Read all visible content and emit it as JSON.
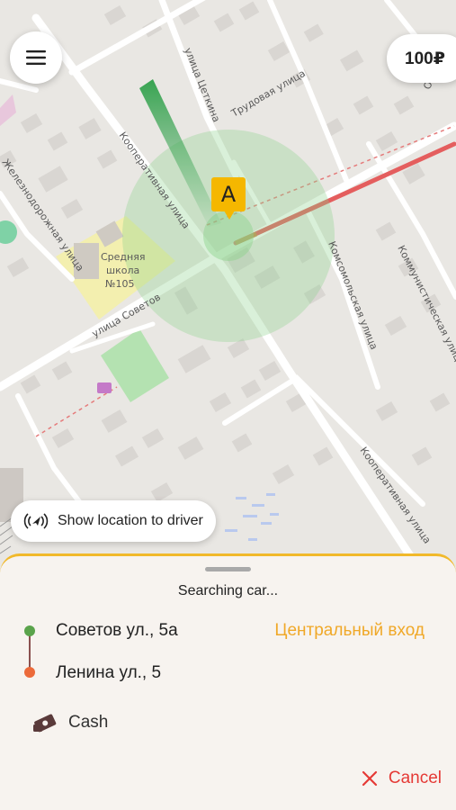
{
  "map": {
    "streets": {
      "tsetkina": "улица Цеткина",
      "trudovaya": "Трудовая улица",
      "kooperativnaya_top": "Кооперативная улица",
      "zheleznodorozhnaya": "Железнодорожная улица",
      "sovetov": "улица Советов",
      "komsomolskaya": "Комсомольская улица",
      "kommunisticheskaya": "Коммунистическая улица",
      "kooperativnaya_bottom": "Кооперативная улица",
      "osipenko": "Осипенко"
    },
    "school": {
      "line1": "Средняя",
      "line2": "школа",
      "line3": "№105"
    },
    "pickup_marker": "A"
  },
  "header": {
    "price": "100₽"
  },
  "show_location": {
    "label": "Show location to driver"
  },
  "sheet": {
    "status": "Searching car...",
    "from": "Советов ул., 5а",
    "entrance": "Центральный вход",
    "to": "Ленина ул., 5",
    "payment": "Cash",
    "cancel": "Cancel"
  },
  "colors": {
    "accent": "#f5b700",
    "sheet_border": "#f1b92a",
    "entrance": "#f0a828",
    "cancel": "#e53935",
    "origin_dot": "#5aa34b",
    "dest_dot": "#ec6a3a"
  },
  "icons": {
    "menu": "hamburger-menu-icon",
    "location": "location-broadcast-icon",
    "payment": "cash-icon",
    "cancel": "close-icon"
  }
}
